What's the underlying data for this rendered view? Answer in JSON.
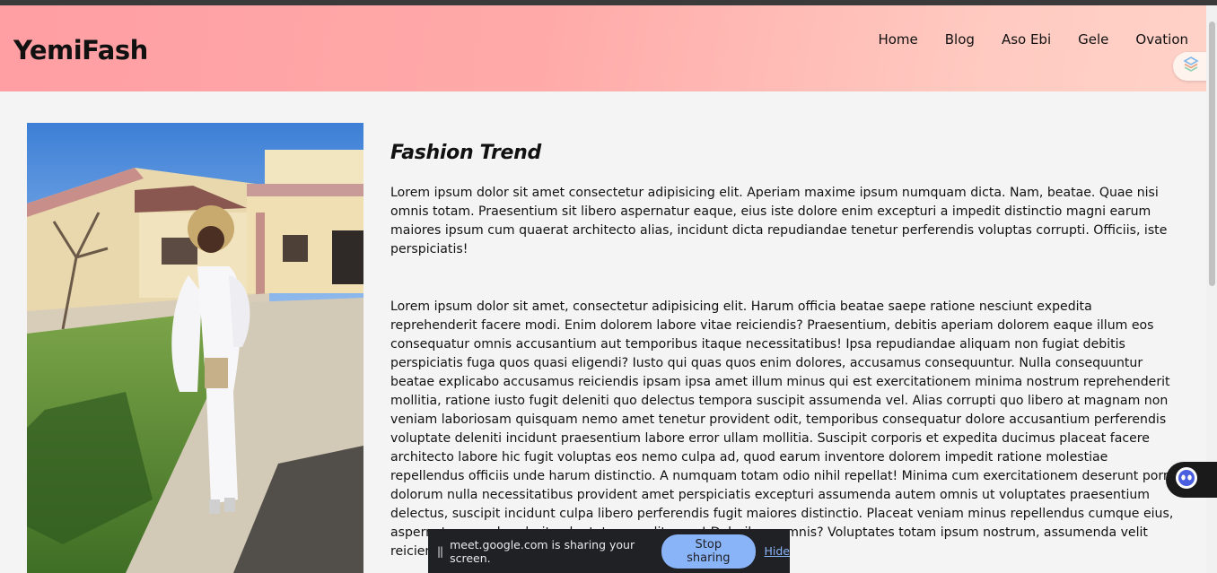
{
  "site": {
    "logo": "YemiFash"
  },
  "nav": {
    "items": [
      "Home",
      "Blog",
      "Aso Ebi",
      "Gele",
      "Ovation"
    ]
  },
  "article": {
    "title": "Fashion Trend",
    "paragraph1": "Lorem ipsum dolor sit amet consectetur adipisicing elit. Aperiam maxime ipsum numquam dicta. Nam, beatae. Quae nisi omnis totam. Praesentium sit libero aspernatur eaque, eius iste dolore enim excepturi a impedit distinctio magni earum maiores ipsum cum quaerat architecto alias, incidunt dicta repudiandae tenetur perferendis voluptas corrupti. Officiis, iste perspiciatis!",
    "paragraph2": "Lorem ipsum dolor sit amet, consectetur adipisicing elit. Harum officia beatae saepe ratione nesciunt expedita reprehenderit facere modi. Enim dolorem labore vitae reiciendis? Praesentium, debitis aperiam dolorem eaque illum eos consequatur omnis accusantium aut temporibus itaque necessitatibus! Ipsa repudiandae aliquam non fugiat debitis perspiciatis fuga quos quasi eligendi? Iusto qui quas quos enim dolores, accusamus consequuntur. Nulla consequuntur beatae explicabo accusamus reiciendis ipsam ipsa amet illum minus qui est exercitationem minima nostrum reprehenderit mollitia, ratione iusto fugit deleniti quo delectus tempora suscipit assumenda vel. Alias corrupti quo libero at magnam non veniam laboriosam quisquam nemo amet tenetur provident odit, temporibus consequatur dolore accusantium perferendis voluptate deleniti incidunt praesentium labore error ullam mollitia. Suscipit corporis et expedita ducimus placeat facere architecto labore hic fugit voluptas eos nemo culpa ad, quod earum inventore dolorem impedit ratione molestiae repellendus officiis unde harum distinctio. A numquam totam odio nihil repellat! Minima cum exercitationem deserunt porro dolorum nulla necessitatibus provident amet perspiciatis excepturi assumenda autem omnis ut voluptates praesentium delectus, suscipit incidunt culpa libero perferendis fugit maiores distinctio. Placeat veniam minus repellendus cumque eius, aspernatur reprehenderit voluptate expedita non! Doloribus, omnis? Voluptates totam ipsum nostrum, assumenda velit reiciendis sunt eos numquam."
  },
  "image": {
    "alt": "Woman in white lace dress and gold gele outside a building"
  },
  "share_bar": {
    "pause_glyph": "||",
    "message": "meet.google.com is sharing your screen.",
    "stop_label": "Stop sharing",
    "hide_label": "Hide"
  },
  "icons": {
    "extension": "layers-extension-icon",
    "assistant": "assistant-bot-icon"
  },
  "colors": {
    "header_gradient_start": "#ff9ea3",
    "header_gradient_end": "#ffd2c8",
    "page_background": "#f4f4f4",
    "share_bar_background": "#202124",
    "stop_button": "#8ab4f8"
  }
}
